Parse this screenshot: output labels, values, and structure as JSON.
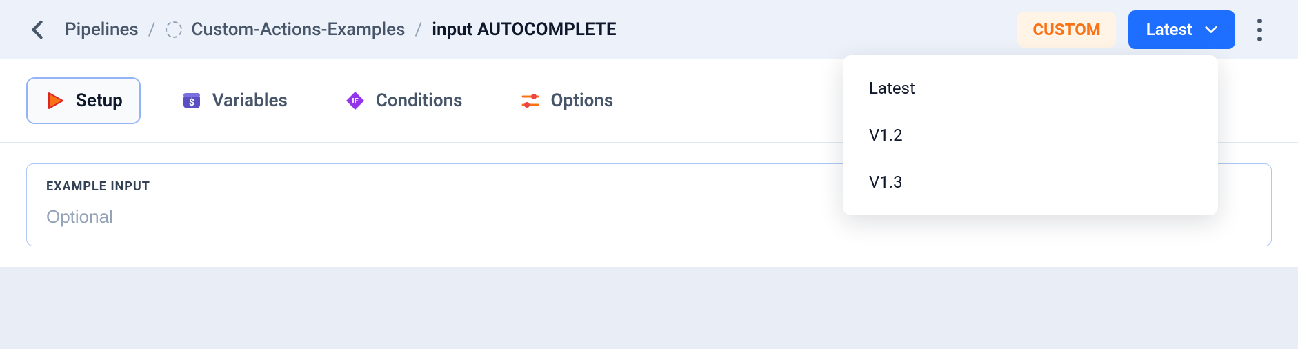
{
  "breadcrumb": {
    "root": "Pipelines",
    "project": "Custom-Actions-Examples",
    "page": "input AUTOCOMPLETE"
  },
  "header": {
    "badge": "CUSTOM",
    "version_label": "Latest"
  },
  "tabs": [
    {
      "label": "Setup"
    },
    {
      "label": "Variables"
    },
    {
      "label": "Conditions"
    },
    {
      "label": "Options"
    }
  ],
  "form": {
    "example_input_label": "EXAMPLE INPUT",
    "example_input_placeholder": "Optional",
    "example_input_value": ""
  },
  "dropdown_items": [
    {
      "label": "Latest"
    },
    {
      "label": "V1.2"
    },
    {
      "label": "V1.3"
    }
  ],
  "colors": {
    "accent": "#1e6fff",
    "custom_badge_bg": "#fff4e6",
    "custom_badge_fg": "#f97316"
  }
}
